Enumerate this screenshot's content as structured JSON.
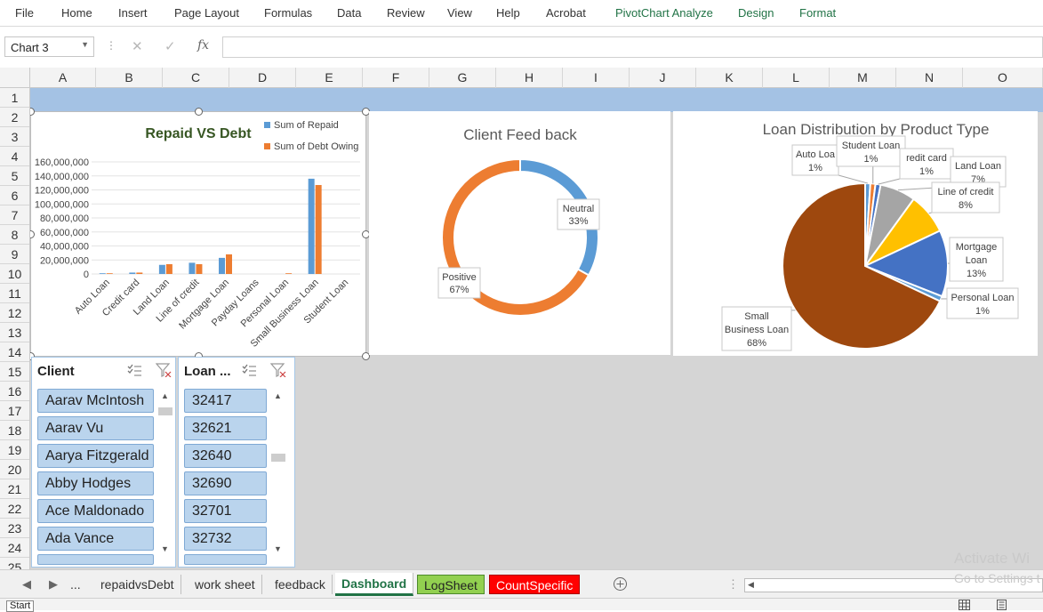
{
  "ribbon": {
    "tabs": [
      "File",
      "Home",
      "Insert",
      "Page Layout",
      "Formulas",
      "Data",
      "Review",
      "View",
      "Help",
      "Acrobat"
    ],
    "contextual_tabs": [
      "PivotChart Analyze",
      "Design",
      "Format"
    ]
  },
  "formula_bar": {
    "name_box": "Chart 3",
    "cancel_icon": "✕",
    "enter_icon": "✓",
    "fx_label": "fx",
    "formula": ""
  },
  "columns": [
    "A",
    "B",
    "C",
    "D",
    "E",
    "F",
    "G",
    "H",
    "I",
    "J",
    "K",
    "L",
    "M",
    "N",
    "O"
  ],
  "rows": [
    "1",
    "2",
    "3",
    "4",
    "5",
    "6",
    "7",
    "8",
    "9",
    "10",
    "11",
    "12",
    "13",
    "14",
    "15",
    "16",
    "17",
    "18",
    "19",
    "20",
    "21",
    "22",
    "23",
    "24",
    "25"
  ],
  "colors": {
    "band": "#a4c2e4",
    "repaid": "#5b9bd5",
    "debt": "#ed7d31",
    "title_green": "#375623",
    "excel_green": "#217346"
  },
  "chart_data": [
    {
      "type": "bar",
      "title": "Repaid VS Debt",
      "categories": [
        "Auto Loan",
        "Credit card",
        "Land Loan",
        "Line of credit",
        "Mortgage Loan",
        "Payday Loans",
        "Personal Loan",
        "Small Business Loan",
        "Student Loan"
      ],
      "series": [
        {
          "name": "Sum of Repaid",
          "values": [
            1000000,
            2000000,
            13000000,
            16000000,
            23000000,
            0,
            0,
            136000000,
            0
          ]
        },
        {
          "name": "Sum of Debt Owing",
          "values": [
            1000000,
            2000000,
            14000000,
            14000000,
            28000000,
            0,
            1000000,
            127000000,
            0
          ]
        }
      ],
      "yticks": [
        "160,000,000",
        "140,000,000",
        "120,000,000",
        "100,000,000",
        "80,000,000",
        "60,000,000",
        "40,000,000",
        "20,000,000",
        "0"
      ],
      "ylim": [
        0,
        160000000
      ],
      "legend": "top-right",
      "grid": true
    },
    {
      "type": "pie",
      "donut": true,
      "title": "Client Feed back",
      "labels": [
        "Neutral",
        "Positive"
      ],
      "values": [
        33,
        67
      ],
      "label_values": [
        "33%",
        "67%"
      ],
      "colors": [
        "#5b9bd5",
        "#ed7d31"
      ]
    },
    {
      "type": "pie",
      "title": "Loan Distribution by Product Type",
      "labels": [
        "Auto Loan",
        "Student Loan",
        "Credit card",
        "Land Loan",
        "Line of credit",
        "Mortgage Loan",
        "Personal Loan",
        "Small Business Loan"
      ],
      "values": [
        1,
        1,
        1,
        7,
        8,
        13,
        1,
        68
      ],
      "label_values": [
        "1%",
        "1%",
        "1%",
        "7%",
        "8%",
        "13%",
        "1%",
        "68%"
      ],
      "callouts": [
        "Auto Loa",
        "Student Loan",
        "redit card",
        "Land Loan",
        "Line of credit",
        "Mortgage Loan",
        "Personal Loan",
        "Small Business Loan"
      ],
      "colors": [
        "#5b9bd5",
        "#ed7d31",
        "#4472c4",
        "#a5a5a5",
        "#ffc000",
        "#4472c4",
        "#5b9bd5",
        "#9e480e"
      ]
    }
  ],
  "slicers": {
    "client": {
      "header": "Client",
      "items": [
        "Aarav McIntosh",
        "Aarav Vu",
        "Aarya Fitzgerald",
        "Abby Hodges",
        "Ace Maldonado",
        "Ada Vance"
      ]
    },
    "loan": {
      "header": "Loan ...",
      "items": [
        "32417",
        "32621",
        "32640",
        "32690",
        "32701",
        "32732"
      ]
    }
  },
  "sheet_tabs": {
    "ellipsis": "...",
    "tabs": [
      "repaidvsDebt",
      "work sheet",
      "feedback",
      "Dashboard",
      "LogSheet",
      "CountSpecific"
    ],
    "active": "Dashboard"
  },
  "watermark": {
    "line1": "Activate Wi",
    "line2": "Go to Settings t"
  },
  "status": {
    "mode": "Start"
  }
}
